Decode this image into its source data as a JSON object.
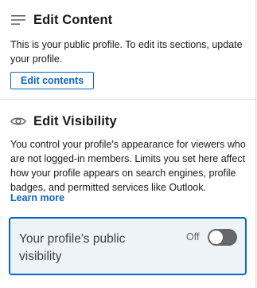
{
  "edit_content": {
    "icon": "menu-lines-icon",
    "title": "Edit Content",
    "description": "This is your public profile. To edit its sections, update your profile.",
    "button_label": "Edit contents"
  },
  "edit_visibility": {
    "icon": "eye-icon",
    "title": "Edit Visibility",
    "description": "You control your profile's appearance for viewers who are not logged-in members. Limits you set here affect how your profile appears on search engines, profile badges, and permitted services like Outlook.",
    "learn_more": "Learn more",
    "toggle": {
      "label": "Your profile's public visibility",
      "state_text": "Off",
      "on": false
    }
  },
  "colors": {
    "accent": "#0a66c2",
    "card_bg": "#eef3f8",
    "switch_off": "#666666"
  }
}
